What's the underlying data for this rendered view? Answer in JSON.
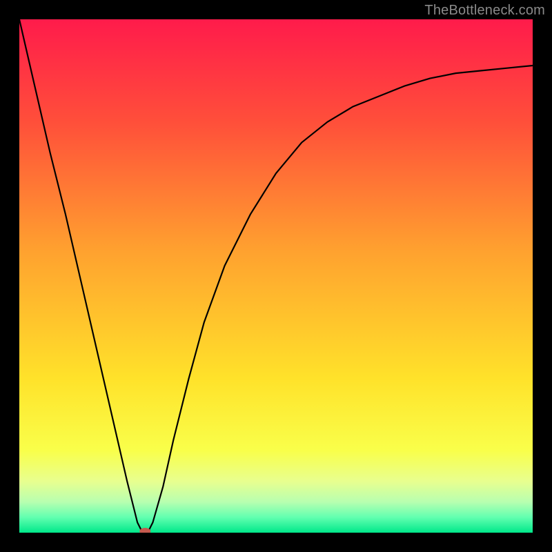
{
  "watermark": "TheBottleneck.com",
  "chart_data": {
    "type": "line",
    "title": "",
    "xlabel": "",
    "ylabel": "",
    "xlim": [
      0,
      100
    ],
    "ylim": [
      0,
      100
    ],
    "grid": false,
    "legend": false,
    "background_gradient": {
      "orientation": "vertical",
      "stops": [
        {
          "pos": 0.0,
          "color": "#ff1b4b"
        },
        {
          "pos": 0.2,
          "color": "#ff4f3a"
        },
        {
          "pos": 0.45,
          "color": "#ffa12f"
        },
        {
          "pos": 0.7,
          "color": "#ffe22a"
        },
        {
          "pos": 0.84,
          "color": "#f9ff4a"
        },
        {
          "pos": 0.9,
          "color": "#e8ff8f"
        },
        {
          "pos": 0.94,
          "color": "#b8ffb0"
        },
        {
          "pos": 0.97,
          "color": "#62ffb0"
        },
        {
          "pos": 1.0,
          "color": "#00e88a"
        }
      ]
    },
    "series": [
      {
        "name": "bottleneck-curve",
        "x": [
          0,
          3,
          6,
          9,
          12,
          15,
          18,
          21,
          23,
          24,
          25,
          26,
          28,
          30,
          33,
          36,
          40,
          45,
          50,
          55,
          60,
          65,
          70,
          75,
          80,
          85,
          90,
          95,
          100
        ],
        "y": [
          100,
          87,
          74,
          62,
          49,
          36,
          23,
          10,
          2,
          0,
          0,
          2,
          9,
          18,
          30,
          41,
          52,
          62,
          70,
          76,
          80,
          83,
          85,
          87,
          88.5,
          89.5,
          90,
          90.5,
          91
        ]
      }
    ],
    "marker": {
      "name": "optimal-point",
      "x": 24.5,
      "y": 0,
      "color": "#c65a4f",
      "rx": 8,
      "ry": 5
    }
  }
}
